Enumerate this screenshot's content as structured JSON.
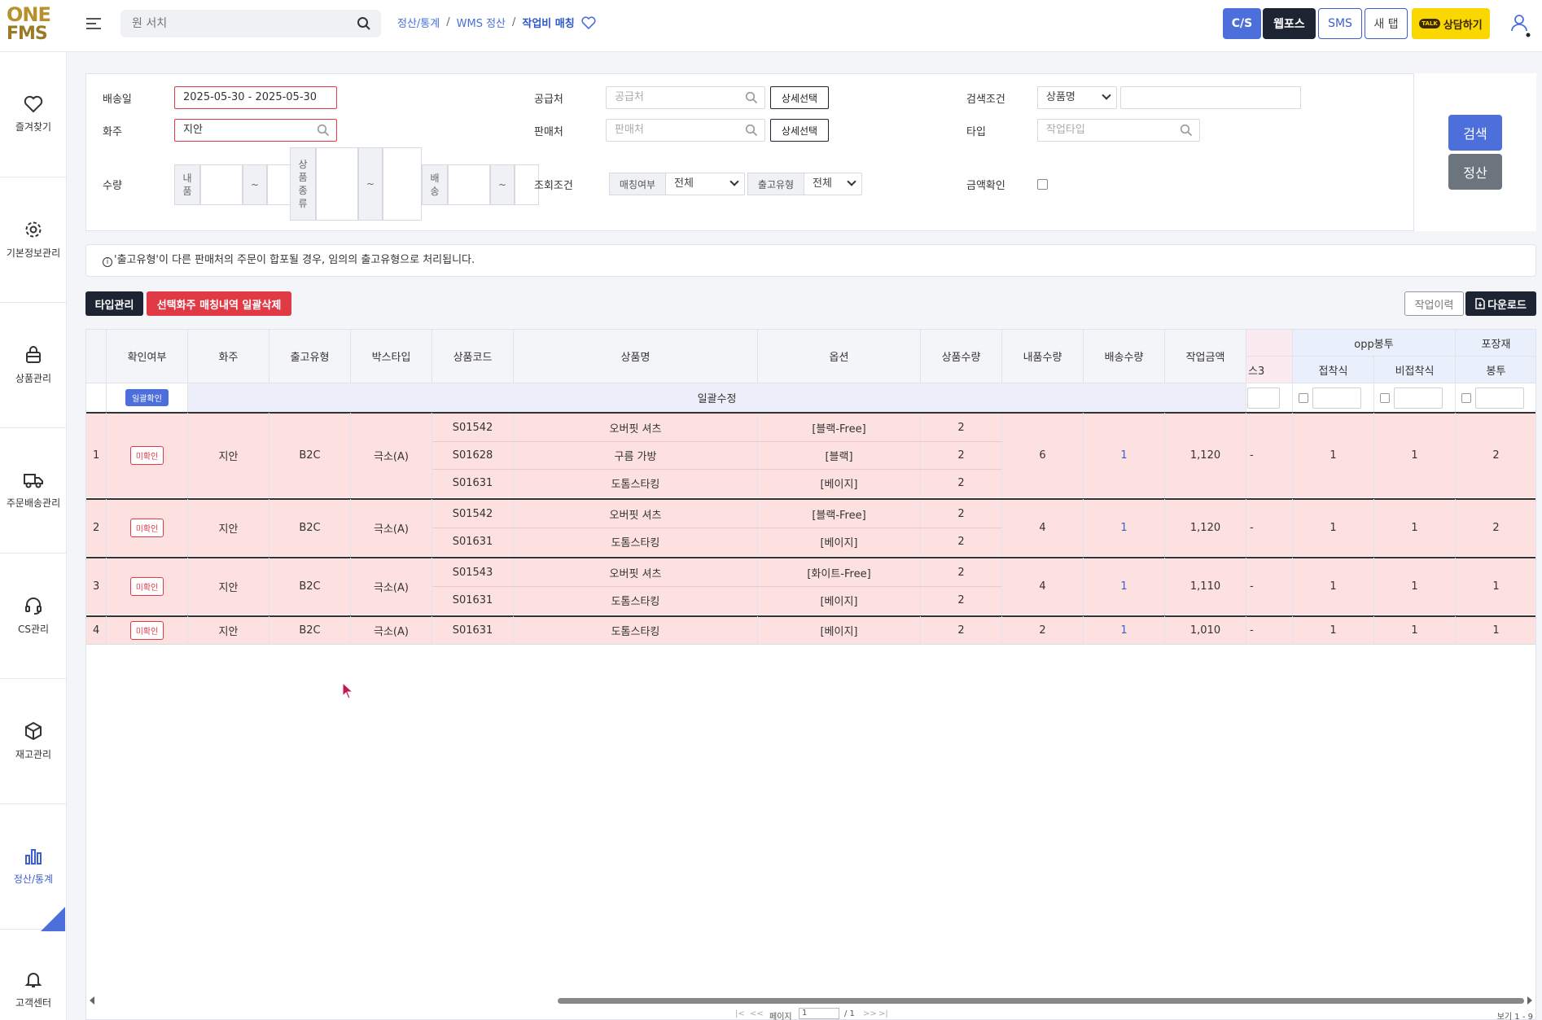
{
  "header": {
    "logo_line1": "ONE",
    "logo_line2": "FMS",
    "search_placeholder": "원 서치",
    "breadcrumb": [
      "정산/통계",
      "WMS 정산",
      "작업비 매칭"
    ],
    "breadcrumb_sep": "/",
    "buttons": {
      "cs": "C/S",
      "web": "웹포스",
      "sms": "SMS",
      "new_tab": "새 탭",
      "talk": "상담하기",
      "talk_badge": "TALK"
    }
  },
  "sidebar": {
    "items": [
      {
        "label": "즐겨찾기",
        "icon": "heart-icon"
      },
      {
        "label": "기본정보관리",
        "icon": "gear-icon"
      },
      {
        "label": "상품관리",
        "icon": "bag-icon"
      },
      {
        "label": "주문배송관리",
        "icon": "truck-icon"
      },
      {
        "label": "CS관리",
        "icon": "headset-icon"
      },
      {
        "label": "재고관리",
        "icon": "box-icon"
      },
      {
        "label": "정산/통계",
        "icon": "bar-chart-icon"
      },
      {
        "label": "고객센터",
        "icon": "bell-icon"
      }
    ],
    "active_index": 6
  },
  "filter": {
    "delivery_date_label": "배송일",
    "delivery_date_value": "2025-05-30 - 2025-05-30",
    "owner_label": "화주",
    "owner_value": "지안",
    "qty_label": "수량",
    "qty_inner_label": "내품",
    "qty_kind_label": "상품종류",
    "qty_ship_label": "배송",
    "tilde": "~",
    "supplier_label": "공급처",
    "supplier_placeholder": "공급처",
    "seller_label": "판매처",
    "seller_placeholder": "판매처",
    "detail_select": "상세선택",
    "query_cond_label": "조회조건",
    "match_label": "매칭여부",
    "match_value": "전체",
    "outtype_label": "출고유형",
    "outtype_value": "전체",
    "search_cond_label": "검색조건",
    "search_cond_value": "상품명",
    "type_label": "타입",
    "type_placeholder": "작업타입",
    "amount_check_label": "금액확인",
    "search_button": "검색",
    "settle_button": "정산"
  },
  "notice": "'출고유형'이 다른 판매처의 주문이 합포될 경우, 임의의 출고유형으로 처리됩니다.",
  "toolbar": {
    "type_mgmt": "타입관리",
    "bulk_delete": "선택화주 매칭내역 일괄삭제",
    "work_log": "작업이력",
    "download": "다운로드"
  },
  "grid": {
    "columns": [
      "확인여부",
      "화주",
      "출고유형",
      "박스타입",
      "상품코드",
      "상품명",
      "옵션",
      "상품수량",
      "내품수량",
      "배송수량",
      "작업금액"
    ],
    "group_opp": "opp봉투",
    "group_pack": "포장재",
    "col_s3": "스3",
    "col_glue": "접착식",
    "col_nonglue": "비접착식",
    "col_bag": "봉투",
    "bulk_confirm": "일괄확인",
    "bulk_edit": "일괄수정",
    "unconfirmed": "미확인",
    "rows": [
      {
        "no": "1",
        "owner": "지안",
        "out_type": "B2C",
        "box": "극소(A)",
        "items": [
          {
            "code": "S01542",
            "name": "오버핏 셔츠",
            "option": "[블랙-Free]",
            "qty": "2"
          },
          {
            "code": "S01628",
            "name": "구름 가방",
            "option": "[블랙]",
            "qty": "2"
          },
          {
            "code": "S01631",
            "name": "도톰스타킹",
            "option": "[베이지]",
            "qty": "2"
          }
        ],
        "inner_qty": "6",
        "ship_qty": "1",
        "amount": "1,120",
        "s3": "-",
        "glue": "1",
        "nonglue": "1",
        "bag": "2"
      },
      {
        "no": "2",
        "owner": "지안",
        "out_type": "B2C",
        "box": "극소(A)",
        "items": [
          {
            "code": "S01542",
            "name": "오버핏 셔츠",
            "option": "[블랙-Free]",
            "qty": "2"
          },
          {
            "code": "S01631",
            "name": "도톰스타킹",
            "option": "[베이지]",
            "qty": "2"
          }
        ],
        "inner_qty": "4",
        "ship_qty": "1",
        "amount": "1,120",
        "s3": "-",
        "glue": "1",
        "nonglue": "1",
        "bag": "2"
      },
      {
        "no": "3",
        "owner": "지안",
        "out_type": "B2C",
        "box": "극소(A)",
        "items": [
          {
            "code": "S01543",
            "name": "오버핏 셔츠",
            "option": "[화이트-Free]",
            "qty": "2"
          },
          {
            "code": "S01631",
            "name": "도톰스타킹",
            "option": "[베이지]",
            "qty": "2"
          }
        ],
        "inner_qty": "4",
        "ship_qty": "1",
        "amount": "1,110",
        "s3": "-",
        "glue": "1",
        "nonglue": "1",
        "bag": "1"
      },
      {
        "no": "4",
        "owner": "지안",
        "out_type": "B2C",
        "box": "극소(A)",
        "items": [
          {
            "code": "S01631",
            "name": "도톰스타킹",
            "option": "[베이지]",
            "qty": "2"
          }
        ],
        "inner_qty": "2",
        "ship_qty": "1",
        "amount": "1,010",
        "s3": "-",
        "glue": "1",
        "nonglue": "1",
        "bag": "1"
      }
    ]
  },
  "pager": {
    "page_label": "페이지",
    "page_value": "1",
    "total_pages": "/ 1",
    "view_range": "보기 1 - 9"
  },
  "colors": {
    "accent": "#4d6fdc",
    "danger": "#e03a46",
    "dark": "#1d2432",
    "row_pink": "#fde0e0"
  }
}
